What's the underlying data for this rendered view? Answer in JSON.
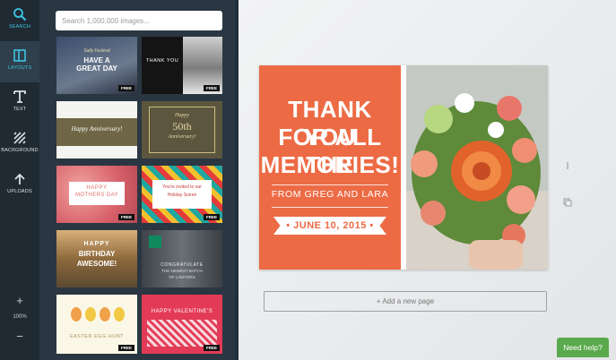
{
  "toolbar": {
    "search_label": "SEARCH",
    "layouts_label": "LAYOUTS",
    "text_label": "TEXT",
    "background_label": "BACKGROUND",
    "uploads_label": "UPLOADS",
    "zoom_in": "+",
    "zoom_value": "100%",
    "zoom_out": "−"
  },
  "panel": {
    "search_placeholder": "Search 1,000,000 images...",
    "free_badge": "FREE",
    "thumbs": {
      "t1_line1": "Sally Festival",
      "t1_line2": "HAVE A",
      "t1_line3": "GREAT DAY",
      "t2_line1": "THANK YOU",
      "t3_text": "Happy Anniversary!",
      "t4_line1": "Happy",
      "t4_line2": "50th",
      "t4_line3": "Anniversary!",
      "t5_line1": "HAPPY",
      "t5_line2": "MOTHERS DAY",
      "t6_line1": "You're invited to our",
      "t6_line2": "Holiday Soiree",
      "t7_line1": "HAPPY",
      "t7_line2": "BIRTHDAY",
      "t7_line3": "AWESOME!",
      "t8_line1": "CONGRATULATE",
      "t8_line2": "THE NEWEST BATCH",
      "t8_line3": "OF LAWYERS",
      "t9_text": "EASTER EGG HUNT",
      "t10_text": "HAPPY VALENTINE'S"
    }
  },
  "design": {
    "line1": "THANK YOU",
    "line2": "FOR ALL THE",
    "line3": "MEMORIES!",
    "from": "FROM GREG AND LARA",
    "date": "• JUNE 10, 2015 •"
  },
  "canvas": {
    "add_page": "+ Add a new page",
    "help": "Need help?"
  },
  "colors": {
    "accent": "#3ec5e3",
    "orange": "#ec6b45",
    "help_green": "#5aa94d"
  }
}
